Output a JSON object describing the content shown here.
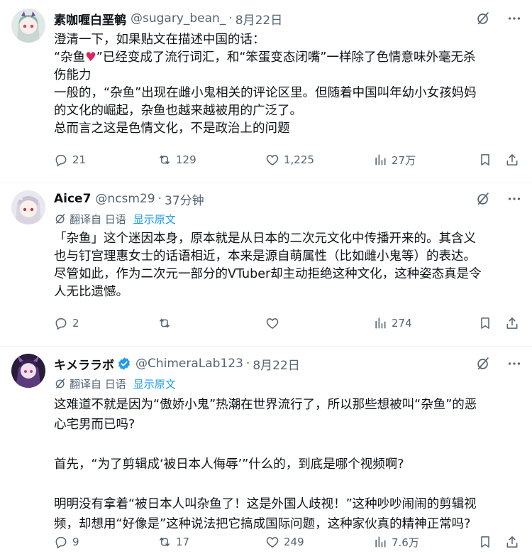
{
  "posts": [
    {
      "name": "素咖喱白垩鹌",
      "handle": "@sugary_bean_",
      "dot": "·",
      "time": "8月22日",
      "text_before_heart": "澄清一下，如果贴文在描述中国的话：\n“杂鱼",
      "heart": "♥",
      "text_after_heart": "”已经变成了流行词汇，和“笨蛋变态闭嘴”一样除了色情意味外毫无杀\n伤能力\n一般的，“杂鱼”出现在雌小鬼相关的评论区里。但随着中国叫年幼小女孩妈妈\n的文化的崛起，杂鱼也越来越被用的广泛了。\n总而言之这是色情文化，不是政治上的问题",
      "stats": {
        "replies": "21",
        "reposts": "129",
        "likes": "1,225",
        "views": "27万"
      }
    },
    {
      "name": "Aice7",
      "handle": "@ncsm29",
      "dot": "·",
      "time": "37分钟",
      "translate_label": "翻译自 日语",
      "translate_link": "显示原文",
      "text": "「杂鱼」这个迷因本身，原本就是从日本的二次元文化中传播开来的。其含义\n也与钉宫理惠女士的话语相近，本来是源自萌属性（比如雌小鬼等）的表达。\n尽管如此，作为二次元一部分的VTuber却主动拒绝这种文化，这种姿态真是令\n人无比遗憾。",
      "stats": {
        "replies": "2",
        "reposts": "",
        "likes": "",
        "views": "274"
      }
    },
    {
      "name": "キメララボ",
      "handle": "@ChimeraLab123",
      "dot": "·",
      "time": "8月22日",
      "translate_label": "翻译自 日语",
      "translate_link": "显示原文",
      "text": "这难道不就是因为“傲娇小鬼”热潮在世界流行了，所以那些想被叫“杂鱼”的恶\n心宅男而已吗?\n\n首先，“为了剪辑成‘被日本人侮辱’”什么的，到底是哪个视频啊?\n\n明明没有拿着“被日本人叫杂鱼了！这是外国人歧视！”这种吵吵闹闹的剪辑视\n频，却想用“好像是”这种说法把它搞成国际问题，这种家伙真的精神正常吗?",
      "stats": {
        "replies": "9",
        "reposts": "17",
        "likes": "249",
        "views": "7.6万"
      }
    }
  ],
  "colors": {
    "text": "#0f1419",
    "muted": "#536471",
    "link": "#1d9bf0",
    "verified": "#1d9bf0",
    "heart": "#e0245e",
    "divider": "#eff3f4"
  },
  "icons": [
    "grok-icon",
    "more-icon",
    "translate-icon",
    "reply-icon",
    "repost-icon",
    "like-icon",
    "views-icon",
    "bookmark-icon",
    "share-icon",
    "verified-icon"
  ]
}
